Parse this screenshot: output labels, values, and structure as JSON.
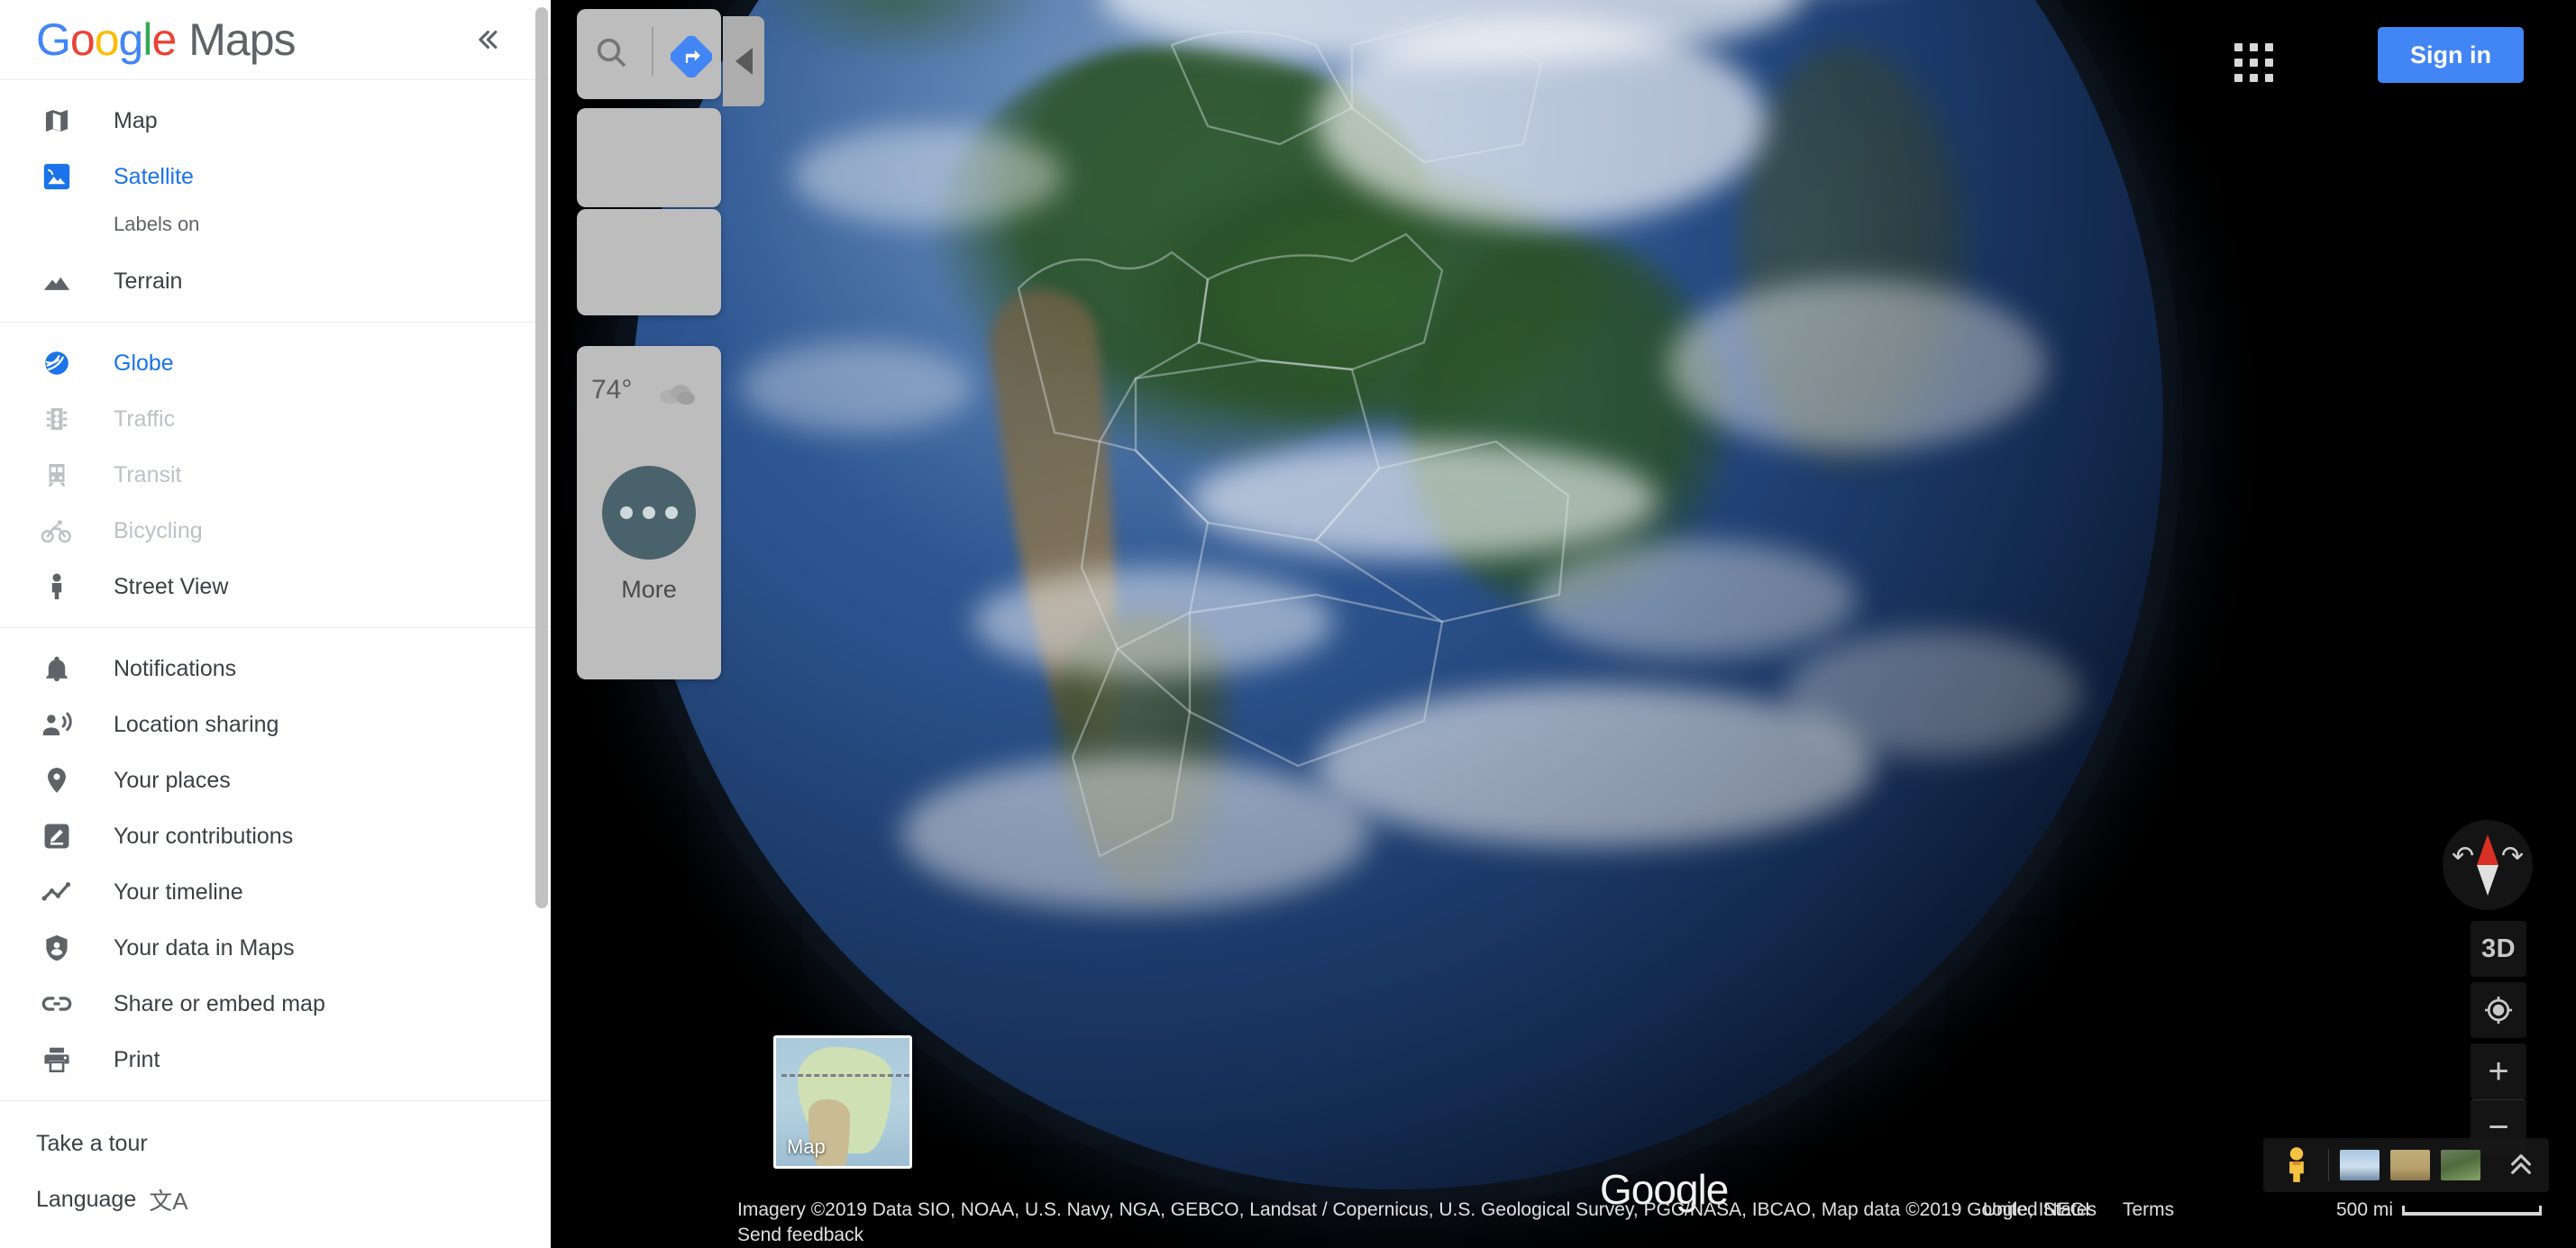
{
  "brand": {
    "google_letters": [
      "G",
      "o",
      "o",
      "g",
      "l",
      "e"
    ],
    "maps_word": "Maps",
    "collapse_icon": "double-chevron-left"
  },
  "sidebar": {
    "layers": [
      {
        "label": "Map",
        "icon": "map-icon",
        "state": "normal"
      },
      {
        "label": "Satellite",
        "icon": "satellite-icon",
        "state": "active"
      },
      {
        "label": "Terrain",
        "icon": "terrain-icon",
        "state": "normal"
      }
    ],
    "satellite_sub_label": "Labels on",
    "overlays": [
      {
        "label": "Globe",
        "icon": "globe-icon",
        "state": "active"
      },
      {
        "label": "Traffic",
        "icon": "traffic-icon",
        "state": "disabled"
      },
      {
        "label": "Transit",
        "icon": "transit-icon",
        "state": "disabled"
      },
      {
        "label": "Bicycling",
        "icon": "bicycling-icon",
        "state": "disabled"
      },
      {
        "label": "Street View",
        "icon": "streetview-icon",
        "state": "normal"
      }
    ],
    "account": [
      {
        "label": "Notifications",
        "icon": "bell-icon"
      },
      {
        "label": "Location sharing",
        "icon": "location-sharing-icon"
      },
      {
        "label": "Your places",
        "icon": "pin-icon"
      },
      {
        "label": "Your contributions",
        "icon": "edit-icon"
      },
      {
        "label": "Your timeline",
        "icon": "timeline-icon"
      },
      {
        "label": "Your data in Maps",
        "icon": "shield-person-icon"
      },
      {
        "label": "Share or embed map",
        "icon": "link-icon"
      },
      {
        "label": "Print",
        "icon": "print-icon"
      }
    ],
    "footer_items": [
      {
        "label": "Take a tour",
        "glyph": ""
      },
      {
        "label": "Language",
        "glyph": "文A"
      }
    ]
  },
  "search_panel": {
    "search_icon": "search-icon",
    "directions_icon": "directions-icon",
    "weather": {
      "temperature": "74°",
      "condition_icon": "cloud-icon"
    },
    "more_button_label": "More",
    "more_icon": "ellipsis-icon",
    "collapse_icon": "triangle-left-icon"
  },
  "topbar": {
    "apps_icon": "apps-grid-icon",
    "sign_in_label": "Sign in"
  },
  "map_controls": {
    "compass_icon": "compass-icon",
    "view_3d_label": "3D",
    "locate_icon": "my-location-icon",
    "zoom_in_label": "+",
    "zoom_out_label": "−"
  },
  "bottom_strip": {
    "pegman_icon": "pegman-icon",
    "thumbnails": [
      "photo-sky",
      "photo-field",
      "photo-trail"
    ],
    "expand_icon": "double-chevron-up-icon"
  },
  "map_type_thumbnail": {
    "caption": "Map"
  },
  "watermark": "Google",
  "footer": {
    "attribution": "Imagery ©2019 Data SIO, NOAA, U.S. Navy, NGA, GEBCO, Landsat / Copernicus, U.S. Geological Survey, PGC/NASA, IBCAO, Map data ©2019 Google, INEGI",
    "country": "United States",
    "terms": "Terms",
    "send_feedback": "Send feedback",
    "scale_label": "500 mi"
  },
  "colors": {
    "google_blue": "#4285F4",
    "link_blue": "#1A73E8",
    "text_gray": "#3C4043",
    "disabled_gray": "#BDC1C6",
    "compass_north": "#D93025"
  }
}
